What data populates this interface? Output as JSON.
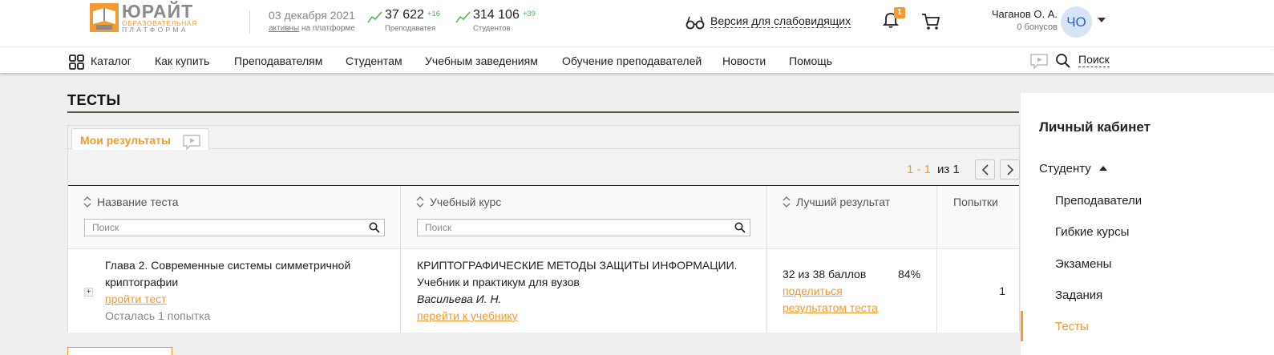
{
  "brand": {
    "name": "ЮРАЙТ",
    "sub1": "ОБРАЗОВАТЕЛЬНАЯ",
    "sub2": "ПЛАТФОРМА",
    "accent_color": "#f49a30"
  },
  "header": {
    "date": "03 декабря 2021",
    "active_link": "активны",
    "active_suffix": "на платформе",
    "stats": [
      {
        "value": "37 622",
        "increase": "+16",
        "label": "Преподаватея"
      },
      {
        "value": "314 106",
        "increase": "+39",
        "label": "Студентов"
      }
    ],
    "vision_label": "Версия для слабовидящих",
    "notifications_count": "1",
    "user": {
      "name": "Чаганов О. А.",
      "bonus": "0 бонусов",
      "initials": "ЧО"
    }
  },
  "nav": {
    "items": [
      "Каталог",
      "Как купить",
      "Преподавателям",
      "Студентам",
      "Учебным заведениям",
      "Обучение преподавателей",
      "Новости",
      "Помощь"
    ],
    "search_label": "Поиск"
  },
  "page": {
    "title": "ТЕСТЫ",
    "tab_label": "Мои результаты",
    "pager": {
      "range": "1 - 1",
      "of": "из 1"
    }
  },
  "table": {
    "columns": [
      {
        "label": "Название теста",
        "filter_placeholder": "Поиск"
      },
      {
        "label": "Учебный курс",
        "filter_placeholder": "Поиск"
      },
      {
        "label": "Лучший результат"
      },
      {
        "label": "Попытки"
      }
    ],
    "rows": [
      {
        "expand": "+",
        "test_name_line1": "Глава 2. Современные системы симметричной",
        "test_name_line2": "криптографии",
        "take_test": "пройти тест",
        "attempts_left": "Осталась 1 попытка",
        "course_line1": "КРИПТОГРАФИЧЕСКИЕ МЕТОДЫ ЗАЩИТЫ ИНФОРМАЦИИ.",
        "course_line2": "Учебник и практикум для вузов",
        "course_author": "Васильева И. Н.",
        "course_link": "перейти к учебнику",
        "score": "32 из 38 баллов",
        "percent": "84%",
        "share_line1": "поделиться",
        "share_line2": "результатом теста",
        "attempts": "1"
      }
    ]
  },
  "sidebar": {
    "title": "Личный кабинет",
    "section": "Студенту",
    "items": [
      "Преподаватели",
      "Гибкие курсы",
      "Экзамены",
      "Задания",
      "Тесты"
    ],
    "active_item": "Тесты"
  }
}
